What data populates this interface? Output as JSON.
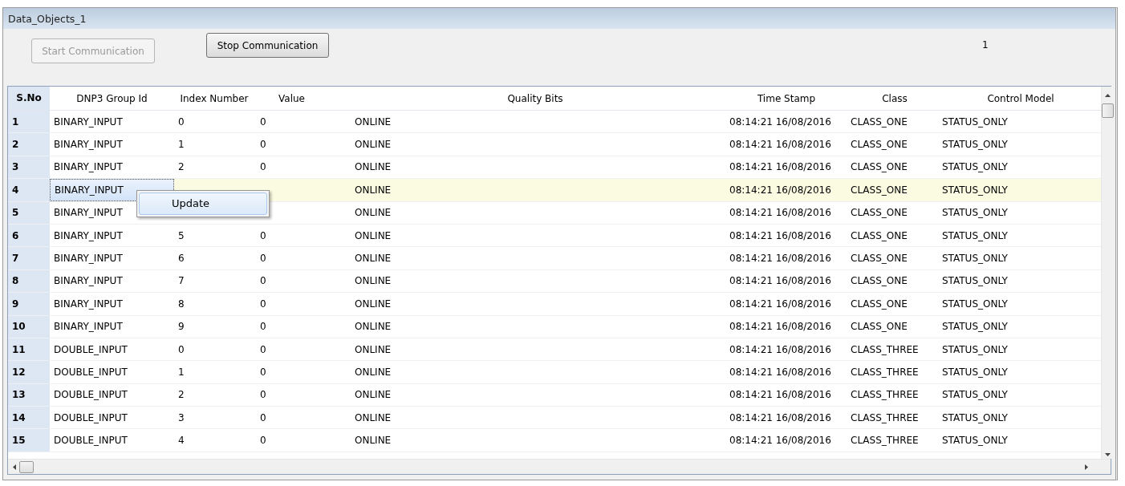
{
  "window": {
    "title": "Data_Objects_1"
  },
  "buttons": [
    {
      "label": "Start Communication",
      "disabled": true
    },
    {
      "label": "Stop Communication",
      "disabled": false
    }
  ],
  "counter": "1",
  "table": {
    "columns": [
      "S.No",
      "DNP3 Group Id",
      "Index Number",
      "Value",
      "Quality Bits",
      "Time Stamp",
      "Class",
      "Control Model"
    ],
    "rows": [
      {
        "sno": "1",
        "group": "BINARY_INPUT",
        "index": "0",
        "value": "0",
        "quality": "ONLINE",
        "timestamp": "08:14:21 16/08/2016",
        "class": "CLASS_ONE",
        "control_model": "STATUS_ONLY",
        "selected": false
      },
      {
        "sno": "2",
        "group": "BINARY_INPUT",
        "index": "1",
        "value": "0",
        "quality": "ONLINE",
        "timestamp": "08:14:21 16/08/2016",
        "class": "CLASS_ONE",
        "control_model": "STATUS_ONLY",
        "selected": false
      },
      {
        "sno": "3",
        "group": "BINARY_INPUT",
        "index": "2",
        "value": "0",
        "quality": "ONLINE",
        "timestamp": "08:14:21 16/08/2016",
        "class": "CLASS_ONE",
        "control_model": "STATUS_ONLY",
        "selected": false
      },
      {
        "sno": "4",
        "group": "BINARY_INPUT",
        "quality": "ONLINE",
        "timestamp": "08:14:21 16/08/2016",
        "class": "CLASS_ONE",
        "control_model": "STATUS_ONLY",
        "selected": true
      },
      {
        "sno": "5",
        "group": "BINARY_INPUT",
        "quality": "ONLINE",
        "timestamp": "08:14:21 16/08/2016",
        "class": "CLASS_ONE",
        "control_model": "STATUS_ONLY",
        "selected": false
      },
      {
        "sno": "6",
        "group": "BINARY_INPUT",
        "index": "5",
        "value": "0",
        "quality": "ONLINE",
        "timestamp": "08:14:21 16/08/2016",
        "class": "CLASS_ONE",
        "control_model": "STATUS_ONLY",
        "selected": false
      },
      {
        "sno": "7",
        "group": "BINARY_INPUT",
        "index": "6",
        "value": "0",
        "quality": "ONLINE",
        "timestamp": "08:14:21 16/08/2016",
        "class": "CLASS_ONE",
        "control_model": "STATUS_ONLY",
        "selected": false
      },
      {
        "sno": "8",
        "group": "BINARY_INPUT",
        "index": "7",
        "value": "0",
        "quality": "ONLINE",
        "timestamp": "08:14:21 16/08/2016",
        "class": "CLASS_ONE",
        "control_model": "STATUS_ONLY",
        "selected": false
      },
      {
        "sno": "9",
        "group": "BINARY_INPUT",
        "index": "8",
        "value": "0",
        "quality": "ONLINE",
        "timestamp": "08:14:21 16/08/2016",
        "class": "CLASS_ONE",
        "control_model": "STATUS_ONLY",
        "selected": false
      },
      {
        "sno": "10",
        "group": "BINARY_INPUT",
        "index": "9",
        "value": "0",
        "quality": "ONLINE",
        "timestamp": "08:14:21 16/08/2016",
        "class": "CLASS_ONE",
        "control_model": "STATUS_ONLY",
        "selected": false
      },
      {
        "sno": "11",
        "group": "DOUBLE_INPUT",
        "index": "0",
        "value": "0",
        "quality": "ONLINE",
        "timestamp": "08:14:21 16/08/2016",
        "class": "CLASS_THREE",
        "control_model": "STATUS_ONLY",
        "selected": false
      },
      {
        "sno": "12",
        "group": "DOUBLE_INPUT",
        "index": "1",
        "value": "0",
        "quality": "ONLINE",
        "timestamp": "08:14:21 16/08/2016",
        "class": "CLASS_THREE",
        "control_model": "STATUS_ONLY",
        "selected": false
      },
      {
        "sno": "13",
        "group": "DOUBLE_INPUT",
        "index": "2",
        "value": "0",
        "quality": "ONLINE",
        "timestamp": "08:14:21 16/08/2016",
        "class": "CLASS_THREE",
        "control_model": "STATUS_ONLY",
        "selected": false
      },
      {
        "sno": "14",
        "group": "DOUBLE_INPUT",
        "index": "3",
        "value": "0",
        "quality": "ONLINE",
        "timestamp": "08:14:21 16/08/2016",
        "class": "CLASS_THREE",
        "control_model": "STATUS_ONLY",
        "selected": false
      },
      {
        "sno": "15",
        "group": "DOUBLE_INPUT",
        "index": "4",
        "value": "0",
        "quality": "ONLINE",
        "timestamp": "08:14:21 16/08/2016",
        "class": "CLASS_THREE",
        "control_model": "STATUS_ONLY",
        "selected": false
      }
    ]
  },
  "context_menu": {
    "items": [
      "Update"
    ]
  }
}
